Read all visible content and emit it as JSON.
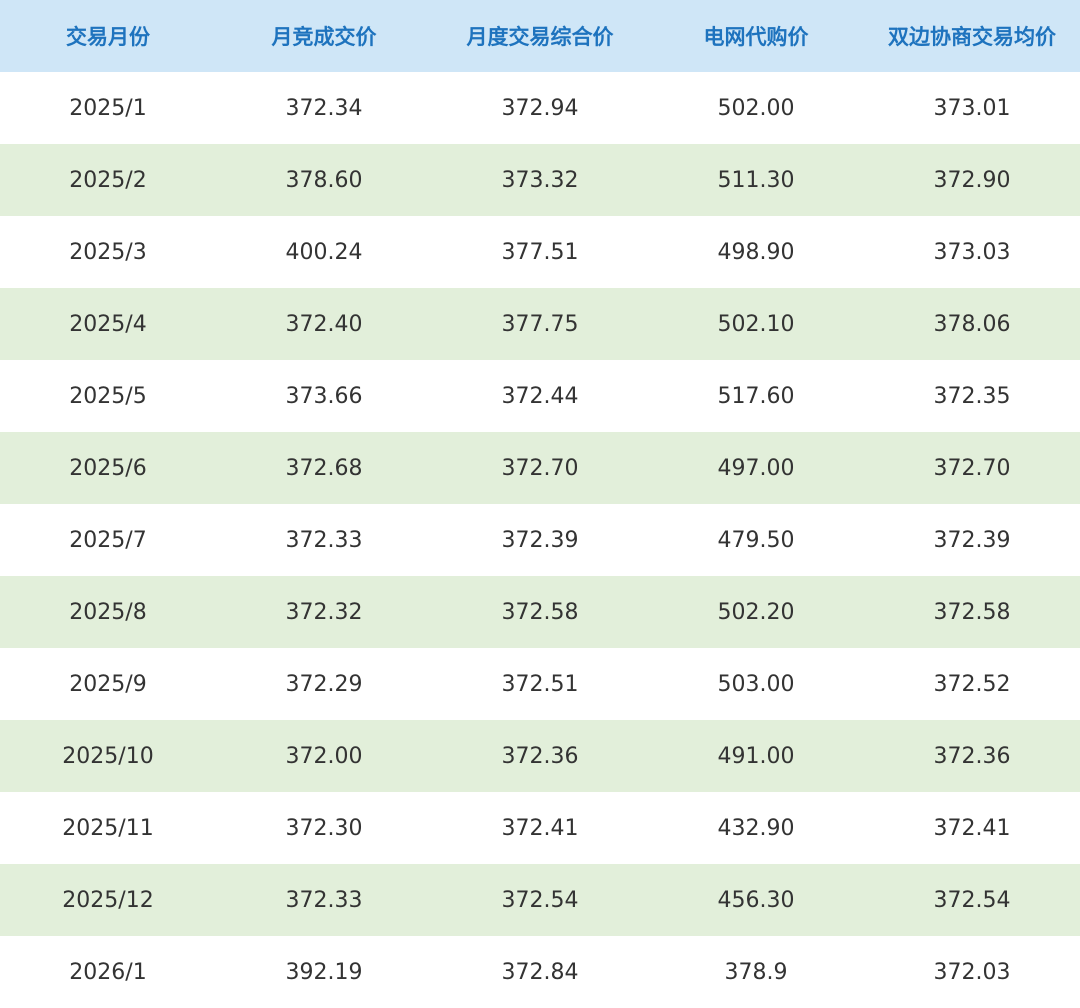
{
  "table": {
    "headers": [
      "交易月份",
      "月竞成交价",
      "月度交易综合价",
      "电网代购价",
      "双边协商交易均价"
    ],
    "rows": [
      [
        "2025/1",
        "372.34",
        "372.94",
        "502.00",
        "373.01"
      ],
      [
        "2025/2",
        "378.60",
        "373.32",
        "511.30",
        "372.90"
      ],
      [
        "2025/3",
        "400.24",
        "377.51",
        "498.90",
        "373.03"
      ],
      [
        "2025/4",
        "372.40",
        "377.75",
        "502.10",
        "378.06"
      ],
      [
        "2025/5",
        "373.66",
        "372.44",
        "517.60",
        "372.35"
      ],
      [
        "2025/6",
        "372.68",
        "372.70",
        "497.00",
        "372.70"
      ],
      [
        "2025/7",
        "372.33",
        "372.39",
        "479.50",
        "372.39"
      ],
      [
        "2025/8",
        "372.32",
        "372.58",
        "502.20",
        "372.58"
      ],
      [
        "2025/9",
        "372.29",
        "372.51",
        "503.00",
        "372.52"
      ],
      [
        "2025/10",
        "372.00",
        "372.36",
        "491.00",
        "372.36"
      ],
      [
        "2025/11",
        "372.30",
        "372.41",
        "432.90",
        "372.41"
      ],
      [
        "2025/12",
        "372.33",
        "372.54",
        "456.30",
        "372.54"
      ],
      [
        "2026/1",
        "392.19",
        "372.84",
        "378.9",
        "372.03"
      ]
    ],
    "colors": {
      "header_bg": "#cfe6f7",
      "header_text": "#1e73be",
      "row_alt_bg": "#e2efda",
      "row_bg": "#ffffff",
      "cell_text": "#333333"
    }
  }
}
